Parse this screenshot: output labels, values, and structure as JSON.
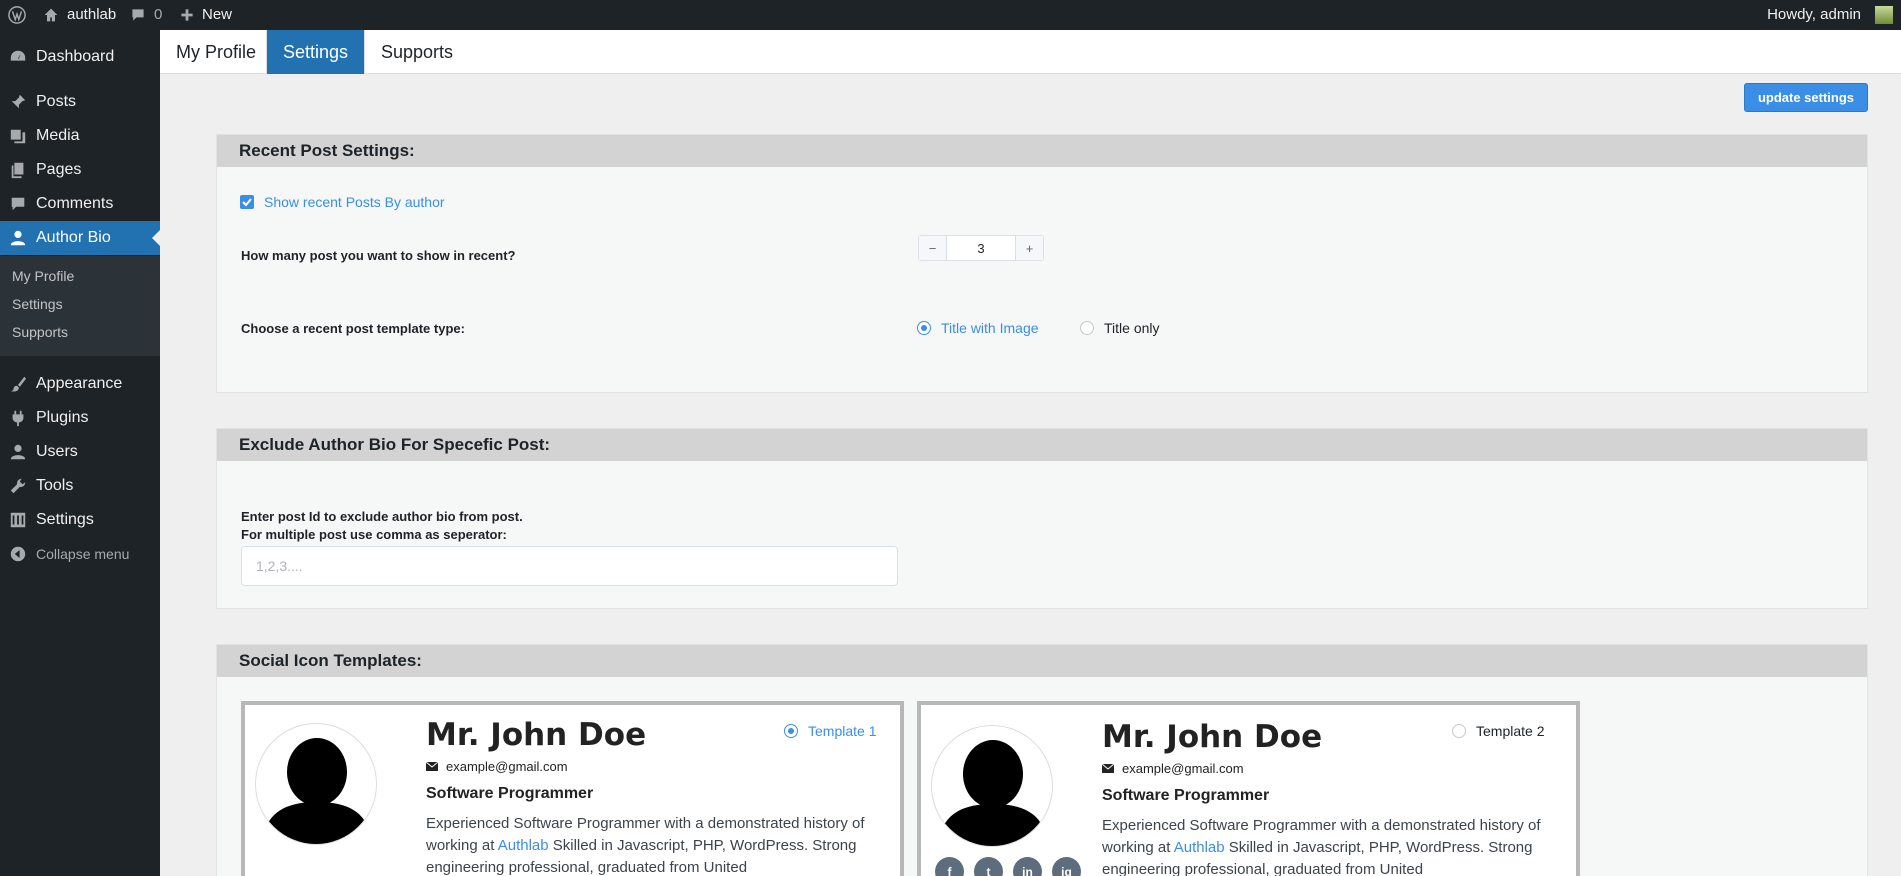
{
  "adminbar": {
    "site_name": "authlab",
    "comments_count": "0",
    "new_label": "New",
    "howdy": "Howdy, admin"
  },
  "sidebar": {
    "items": [
      {
        "label": "Dashboard",
        "icon": "dashboard-icon"
      },
      {
        "label": "Posts",
        "icon": "pin-icon"
      },
      {
        "label": "Media",
        "icon": "media-icon"
      },
      {
        "label": "Pages",
        "icon": "pages-icon"
      },
      {
        "label": "Comments",
        "icon": "comment-icon"
      },
      {
        "label": "Author Bio",
        "icon": "user-icon"
      },
      {
        "label": "Appearance",
        "icon": "brush-icon"
      },
      {
        "label": "Plugins",
        "icon": "plugin-icon"
      },
      {
        "label": "Users",
        "icon": "users-icon"
      },
      {
        "label": "Tools",
        "icon": "wrench-icon"
      },
      {
        "label": "Settings",
        "icon": "settings-icon"
      }
    ],
    "submenu": [
      "My Profile",
      "Settings",
      "Supports"
    ],
    "collapse_label": "Collapse menu"
  },
  "tabs": [
    "My Profile",
    "Settings",
    "Supports"
  ],
  "active_tab": "Settings",
  "update_button": "update settings",
  "recent_posts": {
    "heading": "Recent Post Settings:",
    "checkbox_label": "Show recent Posts By author",
    "checkbox_checked": true,
    "count_label": "How many post you want to show in recent?",
    "count_value": "3",
    "template_label": "Choose a recent post template type:",
    "options": [
      "Title with Image",
      "Title only"
    ],
    "selected_option": "Title with Image"
  },
  "exclude": {
    "heading": "Exclude Author Bio For Specefic Post:",
    "help_line1": "Enter post Id to exclude author bio from post.",
    "help_line2": "For multiple post use comma as seperator:",
    "placeholder": "1,2,3...."
  },
  "social_templates": {
    "heading": "Social Icon Templates:",
    "selected": "Template 1",
    "cards": [
      {
        "template": "Template 1",
        "name": "Mr. John Doe",
        "email": "example@gmail.com",
        "role": "Software Programmer",
        "bio_before": "Experienced Software Programmer with a demonstrated history of working at ",
        "bio_link": "Authlab",
        "bio_after": " Skilled in Javascript,  PHP, WordPress. Strong engineering professional, graduated from United"
      },
      {
        "template": "Template 2",
        "name": "Mr. John Doe",
        "email": "example@gmail.com",
        "role": "Software Programmer",
        "bio_before": "Experienced Software Programmer with a demonstrated history of working at ",
        "bio_link": "Authlab",
        "bio_after": " Skilled in Javascript,  PHP, WordPress. Strong engineering professional, graduated from United"
      }
    ],
    "social_icons": [
      {
        "glyph": "f",
        "icon": "facebook-icon"
      },
      {
        "glyph": "t",
        "icon": "twitter-icon"
      },
      {
        "glyph": "in",
        "icon": "linkedin-icon"
      },
      {
        "glyph": "ig",
        "icon": "instagram-icon"
      }
    ]
  },
  "colors": {
    "wp_dark": "#1d2327",
    "wp_blue": "#2271b1",
    "accent": "#3a8ee6"
  }
}
